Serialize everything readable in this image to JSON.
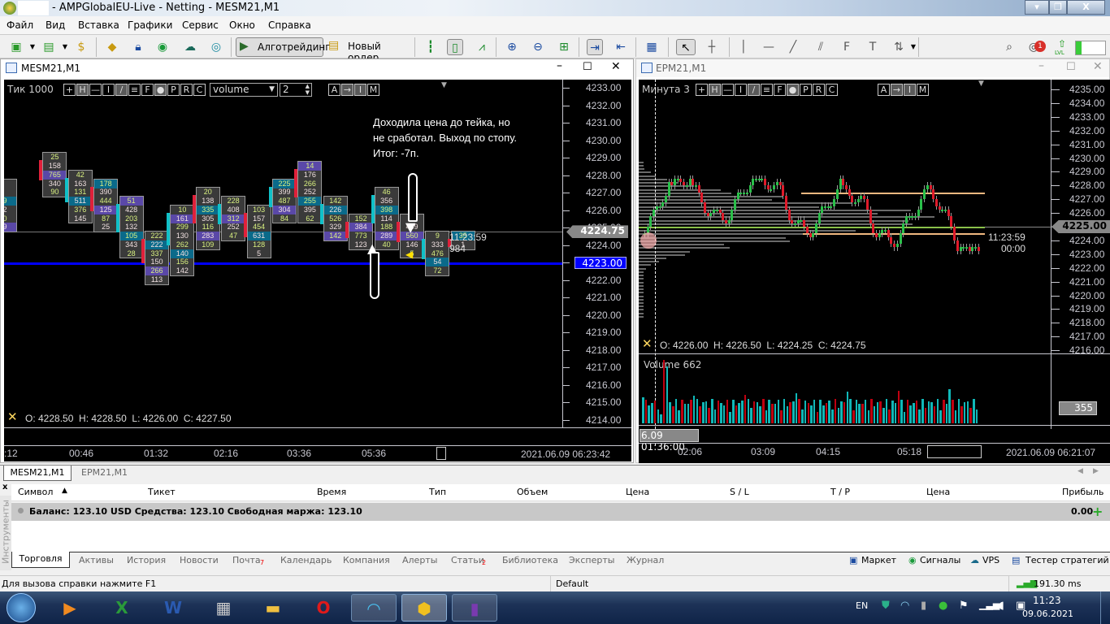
{
  "window": {
    "title": "- AMPGlobalEU-Live - Netting - MESM21,M1",
    "controls": [
      "▾",
      "❐",
      "X"
    ]
  },
  "menu": [
    "Файл",
    "Вид",
    "Вставка",
    "Графики",
    "Сервис",
    "Окно",
    "Справка"
  ],
  "toolbar": {
    "algo": "Алготрейдинг",
    "new_order": "Новый ордер",
    "notifications": "1",
    "lvl": "LVL"
  },
  "left_chart": {
    "title": "MESM21,M1",
    "mode_label": "Тик",
    "mode_value": "1000",
    "buttons": [
      "+",
      "H",
      "—",
      "I",
      "/",
      "≡",
      "F",
      "●",
      "P",
      "R",
      "C"
    ],
    "select_value": "volume",
    "spin_value": "2",
    "right_buttons": [
      "A",
      "→",
      "I",
      "M"
    ],
    "price_ticks": [
      "4233.00",
      "4232.00",
      "4231.00",
      "4230.00",
      "4229.00",
      "4228.00",
      "4227.00",
      "4226.00",
      "4225.00",
      "4224.00",
      "4223.00",
      "4222.00",
      "4221.00",
      "4220.00",
      "4219.00",
      "4218.00",
      "4217.00",
      "4216.00",
      "4215.00",
      "4214.00"
    ],
    "current_price": "4224.75",
    "line_price": "4223.00",
    "timer": "11:23:59",
    "timer_volume": "984",
    "annotation": [
      "Доходила цена до тейка, но",
      "не сработал. Выход по стопу.",
      "Итог: -7п."
    ],
    "ohlc": "O: 4228.50  H: 4228.50  L: 4226.00  C: 4227.50",
    "time_ticks": [
      ":12",
      "00:46",
      "01:32",
      "02:16",
      "03:36",
      "05:36"
    ],
    "time_end": "2021.06.09 06:23:42",
    "accent_blue": "#0000ff",
    "clusters": [
      {
        "top": 4228.0,
        "v": [
          "",
          "",
          "9",
          "2",
          "0",
          "9"
        ]
      },
      {
        "top": 4229.5,
        "v": [
          "25",
          "158",
          "765",
          "340",
          "90"
        ]
      },
      {
        "top": 4228.5,
        "v": [
          "42",
          "163",
          "131",
          "511",
          "376",
          "145"
        ]
      },
      {
        "top": 4228.0,
        "v": [
          "178",
          "390",
          "444",
          "125",
          "87",
          "25"
        ]
      },
      {
        "top": 4227.0,
        "v": [
          "51",
          "428",
          "203",
          "132",
          "105",
          "343",
          "28"
        ]
      },
      {
        "top": 4225.0,
        "v": [
          "222",
          "222",
          "337",
          "150",
          "266",
          "113"
        ]
      },
      {
        "top": 4226.5,
        "v": [
          "10",
          "161",
          "299",
          "130",
          "262",
          "140",
          "156",
          "142"
        ]
      },
      {
        "top": 4227.5,
        "v": [
          "20",
          "138",
          "335",
          "305",
          "116",
          "283",
          "109"
        ]
      },
      {
        "top": 4227.0,
        "v": [
          "228",
          "408",
          "312",
          "252",
          "47"
        ]
      },
      {
        "top": 4226.5,
        "v": [
          "103",
          "157",
          "454",
          "631",
          "128",
          "5"
        ]
      },
      {
        "top": 4228.0,
        "v": [
          "225",
          "399",
          "487",
          "304",
          "84"
        ]
      },
      {
        "top": 4229.0,
        "v": [
          "14",
          "176",
          "266",
          "252",
          "255",
          "395",
          "62"
        ]
      },
      {
        "top": 4227.0,
        "v": [
          "142",
          "226",
          "526",
          "329",
          "142"
        ]
      },
      {
        "top": 4226.0,
        "v": [
          "152",
          "384",
          "773",
          "123"
        ]
      },
      {
        "top": 4227.5,
        "v": [
          "46",
          "356",
          "398",
          "114",
          "188",
          "289",
          "40"
        ]
      },
      {
        "top": 4226.0,
        "v": [
          "30",
          "469",
          "560",
          "146",
          "5"
        ]
      },
      {
        "top": 4225.0,
        "v": [
          "9",
          "333",
          "476",
          "54",
          "72"
        ]
      },
      {
        "top": 4225.0,
        "v": [
          "35",
          "1"
        ]
      }
    ]
  },
  "right_chart": {
    "title": "EPM21,M1",
    "mode_label": "Минута",
    "mode_value": "3",
    "buttons": [
      "+",
      "H",
      "—",
      "I",
      "/",
      "≡",
      "F",
      "●",
      "P",
      "R",
      "C"
    ],
    "right_buttons": [
      "A",
      "→",
      "I",
      "M"
    ],
    "price_ticks": [
      "4235.00",
      "4234.00",
      "4233.00",
      "4232.00",
      "4231.00",
      "4230.00",
      "4229.00",
      "4228.00",
      "4227.00",
      "4226.00",
      "4225.00",
      "4224.00",
      "4223.00",
      "4222.00",
      "4221.00",
      "4220.00",
      "4219.00",
      "4218.00",
      "4217.00",
      "4216.00"
    ],
    "current_price": "4225.00",
    "timer": "11:23:59",
    "timer_sub": "00:00",
    "ohlc": "O: 4226.00  H: 4226.50  L: 4224.25  C: 4224.75",
    "volume_label": "Volume 662",
    "volume_value": "355",
    "crosshair_time": "6.09 01:36:00",
    "time_ticks": [
      "02:06",
      "03:09",
      "04:15",
      "05:18"
    ],
    "time_end": "2021.06.09 06:21:07",
    "level_color": "#f0b880"
  },
  "chart_tabs": [
    "MESM21,M1",
    "EPM21,M1"
  ],
  "terminal": {
    "side_label": "Инструменты",
    "columns": [
      "Символ",
      "Тикет",
      "Время",
      "Тип",
      "Объем",
      "Цена",
      "S / L",
      "T / P",
      "Цена",
      "Прибыль"
    ],
    "balance_row": "Баланс: 123.10 USD  Средства: 123.10  Свободная маржа: 123.10",
    "profit": "0.00",
    "tabs": [
      "Торговля",
      "Активы",
      "История",
      "Новости",
      "Почта",
      "Календарь",
      "Компания",
      "Алерты",
      "Статьи",
      "Библиотека",
      "Эксперты",
      "Журнал"
    ],
    "mail_badge": "7",
    "articles_badge": "2",
    "right_links": [
      "Маркет",
      "Сигналы",
      "VPS",
      "Тестер стратегий"
    ]
  },
  "status": {
    "help": "Для вызова справки нажмите F1",
    "profile": "Default",
    "ping": "191.30 ms"
  },
  "taskbar": {
    "lang": "EN",
    "time": "11:23",
    "date": "09.06.2021"
  }
}
